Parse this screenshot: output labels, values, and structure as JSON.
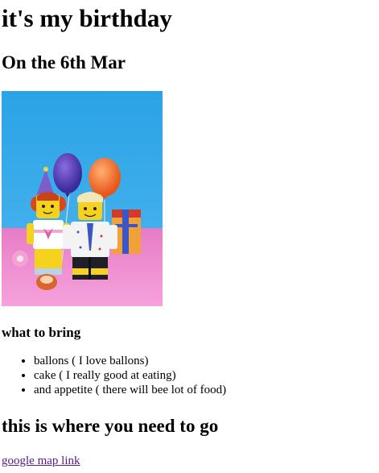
{
  "header": {
    "title": "it's my birthday",
    "date_line": "On the 6th Mar"
  },
  "image": {
    "alt": "lego birthday minifigures with balloons"
  },
  "bring": {
    "heading": "what to bring",
    "items": [
      "ballons ( I love ballons)",
      "cake ( I really good at eating)",
      "and appetite ( there will bee lot of food)"
    ]
  },
  "location": {
    "heading": "this is where you need to go",
    "link_label": "google map link"
  },
  "colors": {
    "link_visited": "#551a8b",
    "photo_sky": "#2f9de0",
    "photo_floor": "#f08ad0"
  }
}
